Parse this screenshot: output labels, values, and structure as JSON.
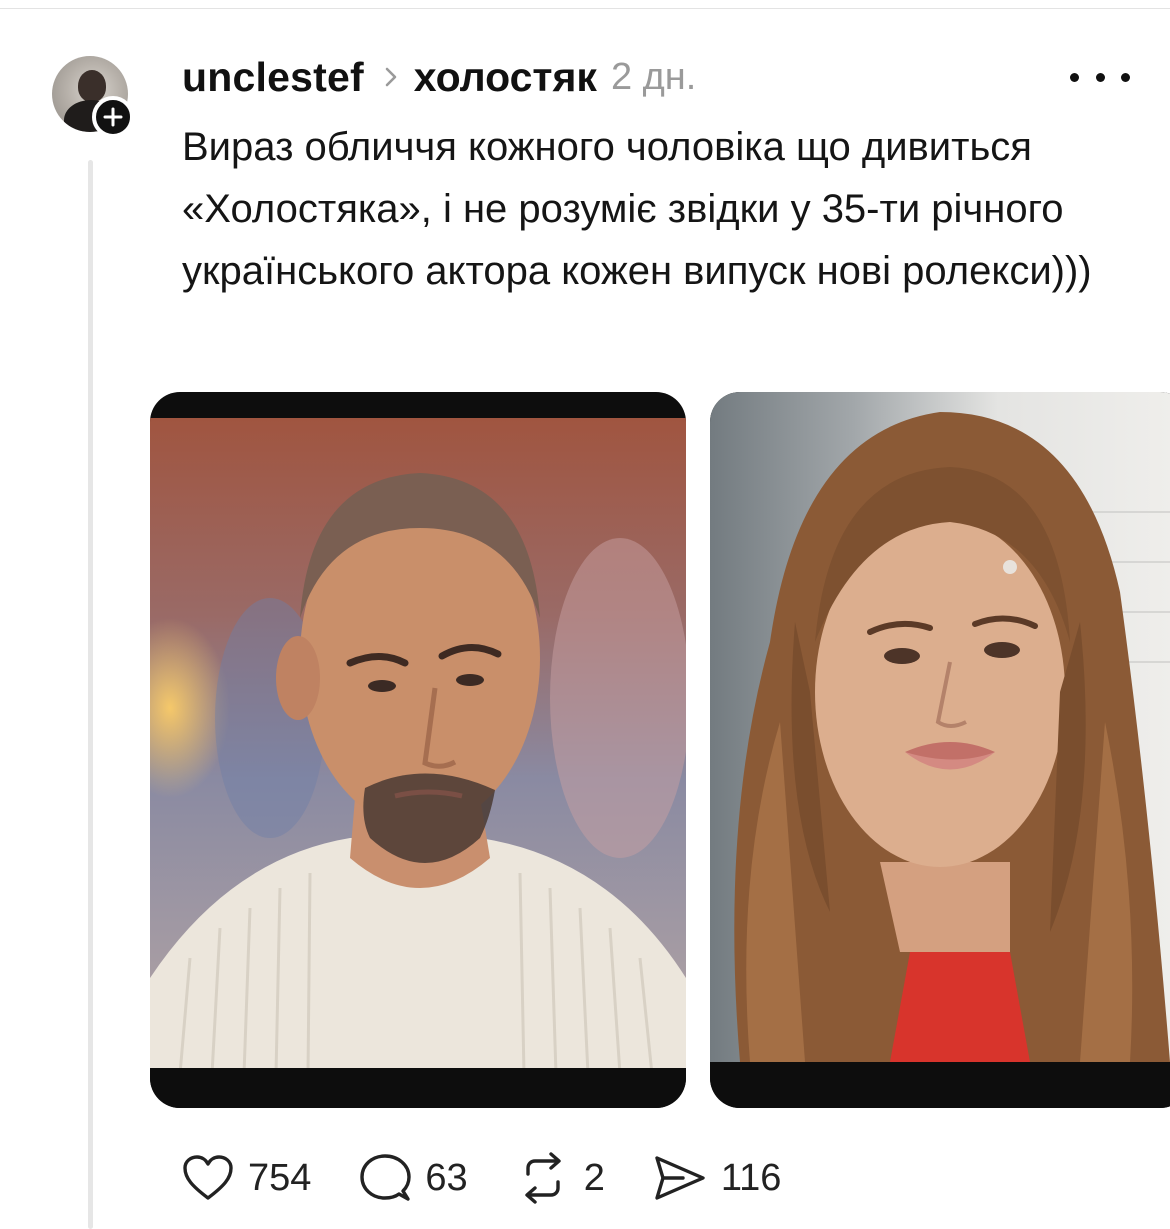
{
  "post": {
    "username": "unclestef",
    "community": "холостяк",
    "time": "2 дн.",
    "text": "Вираз обличчя кожного чоловіка що дивиться «Холостяка», і не розуміє звідки у 35-ти річного українського актора кожен випуск нові ролекси)))"
  },
  "icons": {
    "avatar": "user-avatar",
    "follow": "plus-icon",
    "chevron": "chevron-right-icon",
    "more": "more-icon",
    "like": "heart-icon",
    "reply": "comment-bubble-icon",
    "repost": "repost-icon",
    "share": "send-icon"
  },
  "actions": {
    "likes": "754",
    "replies": "63",
    "reposts": "2",
    "shares": "116"
  },
  "colors": {
    "text": "#111111",
    "muted": "#9a9a9a",
    "thread_line": "#e6e6e6"
  }
}
